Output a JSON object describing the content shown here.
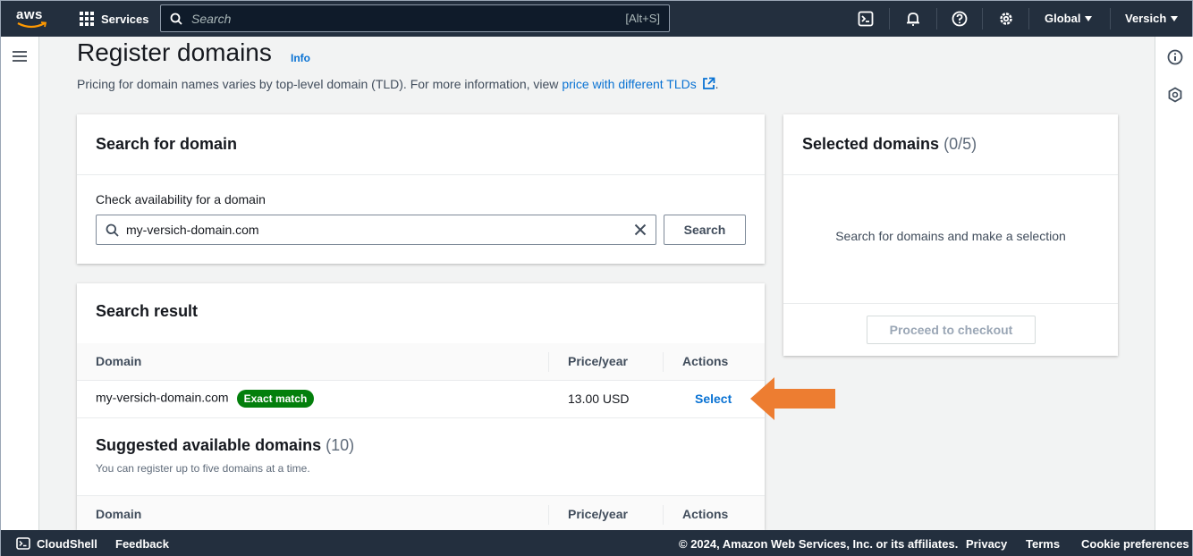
{
  "topnav": {
    "logo_text": "aws",
    "services_label": "Services",
    "search_placeholder": "Search",
    "search_shortcut": "[Alt+S]",
    "icons": [
      "cloudshell-icon",
      "bell-icon",
      "help-icon",
      "settings-icon"
    ],
    "region_label": "Global",
    "account_label": "Versich"
  },
  "page": {
    "title": "Register domains",
    "info_link": "Info",
    "description_prefix": "Pricing for domain names varies by top-level domain (TLD). For more information, view ",
    "description_link": "price with different TLDs",
    "description_suffix": "."
  },
  "search_card": {
    "header": "Search for domain",
    "field_label": "Check availability for a domain",
    "input_value": "my-versich-domain.com",
    "search_button": "Search"
  },
  "selected_card": {
    "header": "Selected domains",
    "count": "(0/5)",
    "empty_text": "Search for domains and make a selection",
    "checkout_button": "Proceed to checkout"
  },
  "result_card": {
    "header": "Search result",
    "columns": [
      "Domain",
      "Price/year",
      "Actions"
    ],
    "row": {
      "domain": "my-versich-domain.com",
      "badge": "Exact match",
      "price": "13.00 USD",
      "action": "Select"
    },
    "suggested_header": "Suggested available domains",
    "suggested_count": "(10)",
    "suggested_subtitle": "You can register up to five domains at a time.",
    "suggested_columns": [
      "Domain",
      "Price/year",
      "Actions"
    ]
  },
  "footer": {
    "cloudshell": "CloudShell",
    "feedback": "Feedback",
    "copyright": "© 2024, Amazon Web Services, Inc. or its affiliates.",
    "privacy": "Privacy",
    "terms": "Terms",
    "cookies": "Cookie preferences"
  },
  "colors": {
    "nav_bg": "#232f3e",
    "link": "#0972d3",
    "badge_green": "#037f0c",
    "arrow_orange": "#ed7d31"
  }
}
